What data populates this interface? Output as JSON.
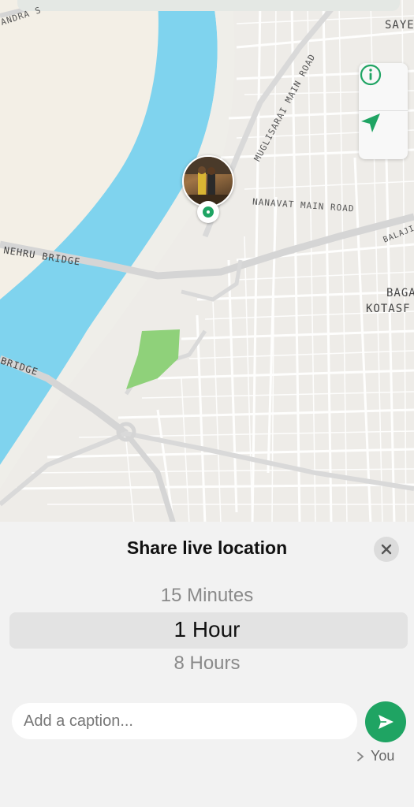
{
  "map": {
    "labels": {
      "sayed": "SAYE",
      "andra": "ANDRA S",
      "mugli": "MUGLISARAI MAIN ROAD",
      "nanavat": "NANAVAT MAIN ROAD",
      "balaji": "BALAJI",
      "nehru": "NEHRU BRIDGE",
      "baga1": "BAGA",
      "baga2": "KOTASF",
      "bridge": "BRIDGE"
    },
    "controls": {
      "info_icon": "info-icon",
      "locate_icon": "navigation-arrow-icon"
    },
    "colors": {
      "river": "#7fd3ee",
      "land": "#f3efe6",
      "park": "#8fd17a",
      "roads": "#ffffff"
    }
  },
  "sheet": {
    "title": "Share live location",
    "close_icon": "close-icon",
    "durations": [
      {
        "label": "15 Minutes"
      },
      {
        "label": "1 Hour",
        "selected": true
      },
      {
        "label": "8 Hours"
      }
    ],
    "caption_placeholder": "Add a caption...",
    "send_icon": "send-icon",
    "recipient": "You",
    "accent": "#1fa463"
  }
}
